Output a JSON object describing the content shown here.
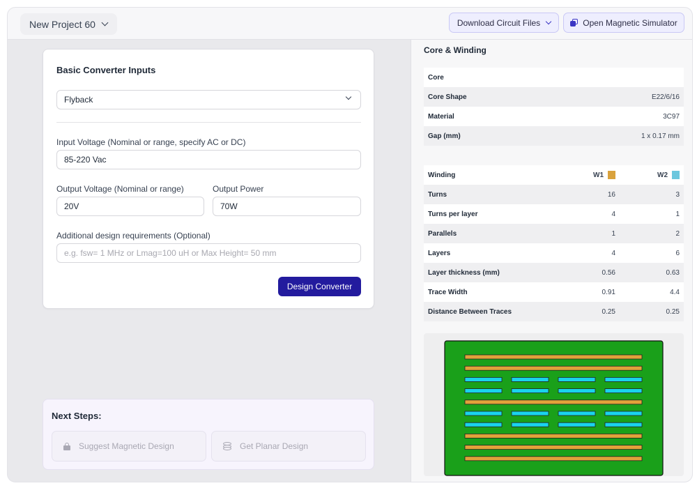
{
  "header": {
    "project_label": "New Project 60",
    "download_label": "Download Circuit Files",
    "simulator_label": "Open Magnetic Simulator"
  },
  "inputs": {
    "title": "Basic Converter Inputs",
    "topology": "Flyback",
    "input_voltage_label": "Input Voltage (Nominal or range, specify AC or DC)",
    "input_voltage_value": "85-220 Vac",
    "output_voltage_label": "Output Voltage (Nominal or range)",
    "output_voltage_value": "20V",
    "output_power_label": "Output Power",
    "output_power_value": "70W",
    "additional_label": "Additional design requirements (Optional)",
    "additional_placeholder": "e.g. fsw= 1 MHz or Lmag=100 uH or Max Height= 50 mm",
    "design_button": "Design Converter"
  },
  "next_steps": {
    "title": "Next Steps:",
    "suggest_label": "Suggest Magnetic Design",
    "planar_label": "Get Planar Design"
  },
  "core_winding": {
    "title": "Core & Winding",
    "core_header": "Core",
    "core_rows": [
      {
        "label": "Core Shape",
        "value": "E22/6/16"
      },
      {
        "label": "Material",
        "value": "3C97"
      },
      {
        "label": "Gap (mm)",
        "value": "1 x 0.17 mm"
      }
    ],
    "winding_header": "Winding",
    "w1_label": "W1",
    "w2_label": "W2",
    "w1_color": "#d9a23d",
    "w2_color": "#6cc7de",
    "winding_rows": [
      {
        "label": "Turns",
        "w1": "16",
        "w2": "3"
      },
      {
        "label": "Turns per layer",
        "w1": "4",
        "w2": "1"
      },
      {
        "label": "Parallels",
        "w1": "1",
        "w2": "2"
      },
      {
        "label": "Layers",
        "w1": "4",
        "w2": "6"
      },
      {
        "label": "Layer thickness (mm)",
        "w1": "0.56",
        "w2": "0.63"
      },
      {
        "label": "Trace Width",
        "w1": "0.91",
        "w2": "4.4"
      },
      {
        "label": "Distance Between Traces",
        "w1": "0.25",
        "w2": "0.25"
      }
    ]
  },
  "diagram": {
    "board_color": "#1aa01a",
    "w1_trace_color": "#e0a23a",
    "w2_trace_color": "#19d3ee",
    "layers": [
      "W1",
      "W1",
      "W2",
      "W2",
      "W1",
      "W2",
      "W2",
      "W1",
      "W1",
      "W1"
    ],
    "w2_traces_per_layer": 4
  }
}
